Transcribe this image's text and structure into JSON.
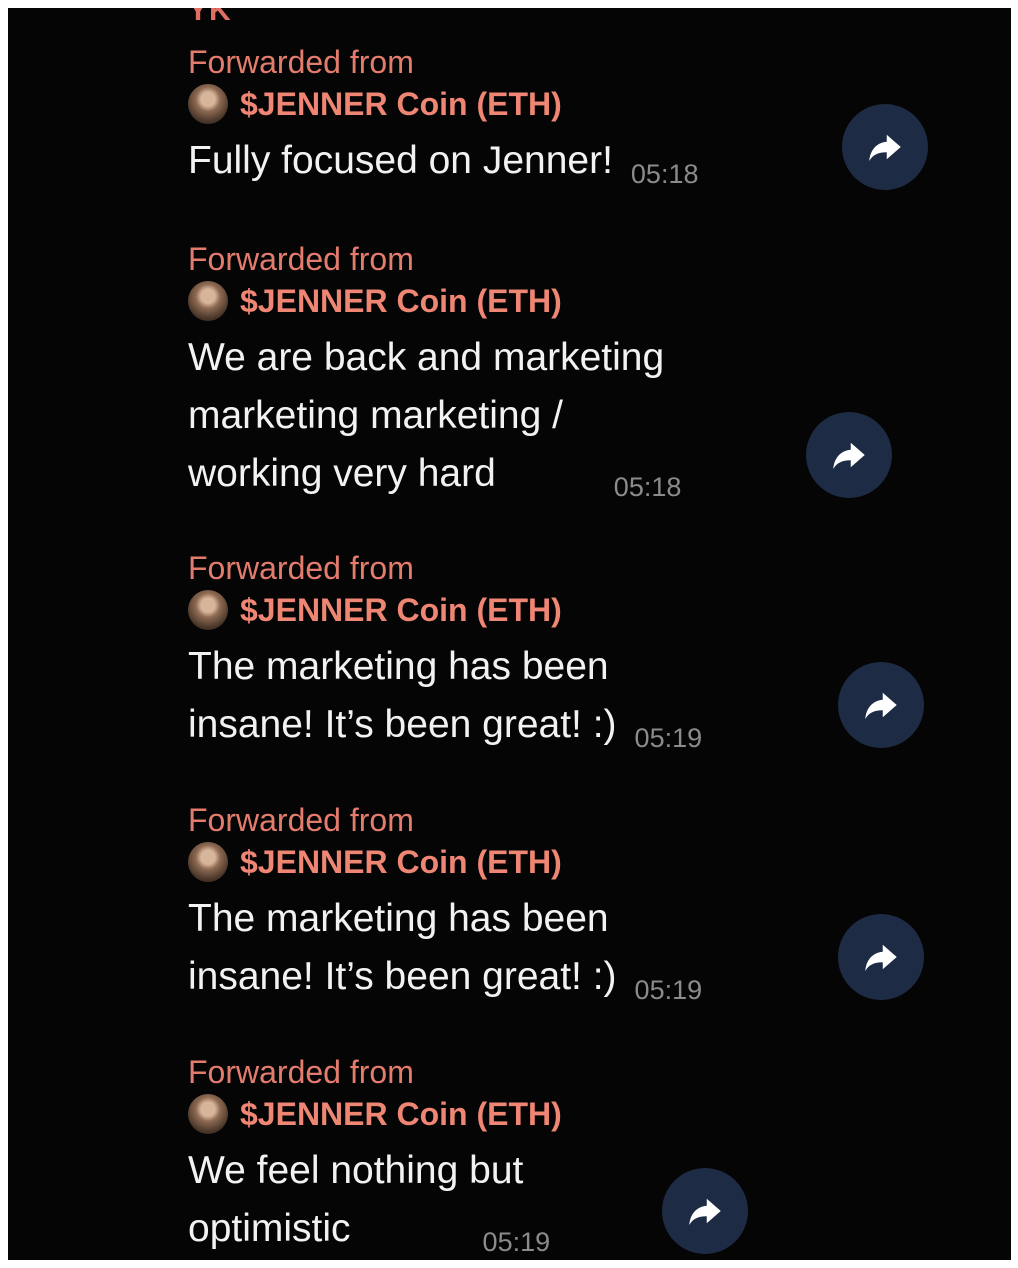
{
  "chat": {
    "top_sender": "YK",
    "messages": [
      {
        "forwarded_label": "Forwarded from",
        "channel": "$JENNER Coin (ETH)",
        "lines": [
          "Fully focused on Jenner!"
        ],
        "time": "05:18"
      },
      {
        "forwarded_label": "Forwarded from",
        "channel": "$JENNER Coin (ETH)",
        "lines": [
          "We are back and marketing",
          "marketing marketing /",
          "working very hard"
        ],
        "time": "05:18"
      },
      {
        "forwarded_label": "Forwarded from",
        "channel": "$JENNER Coin (ETH)",
        "lines": [
          "The marketing has been",
          "insane! It’s been great! :)"
        ],
        "time": "05:19"
      },
      {
        "forwarded_label": "Forwarded from",
        "channel": "$JENNER Coin (ETH)",
        "lines": [
          "The marketing has been",
          "insane! It’s been great! :)"
        ],
        "time": "05:19"
      },
      {
        "forwarded_label": "Forwarded from",
        "channel": "$JENNER Coin (ETH)",
        "lines": [
          "We feel nothing but",
          "optimistic"
        ],
        "time": "05:19"
      }
    ],
    "share_icon": "share-arrow-icon",
    "colors": {
      "background": "#050505",
      "forwarded_label": "#e47c6e",
      "channel_name": "#ef8573",
      "message_text": "#f2f2f2",
      "timestamp": "#8b8b8b",
      "share_button": "#1e2b44"
    }
  }
}
